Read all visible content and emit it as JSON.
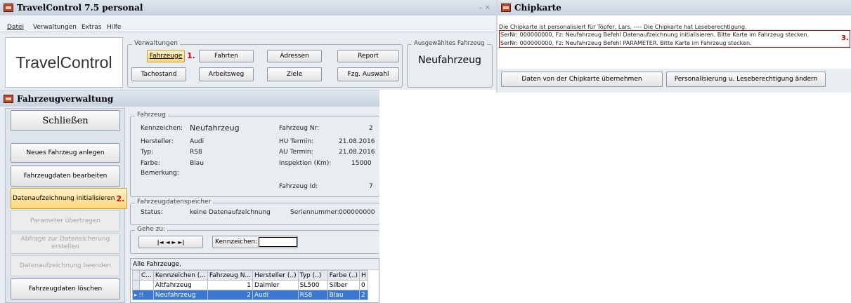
{
  "main_window": {
    "title": "TravelControl 7.5  personal",
    "menu": [
      "Datei",
      "Verwaltungen",
      "Extras",
      "Hilfe"
    ],
    "controls": "– ✕"
  },
  "brand": "TravelControl",
  "verwaltungen": {
    "legend": "Verwaltungen",
    "buttons": {
      "fahrzeuge": "Fahrzeuge",
      "fahrten": "Fahrten",
      "adressen": "Adressen",
      "report": "Report",
      "tachostand": "Tachostand",
      "arbeitsweg": "Arbeitsweg",
      "ziele": "Ziele",
      "fzg_auswahl": "Fzg. Auswahl"
    },
    "step": "1."
  },
  "selected_vehicle": {
    "legend": "Ausgewähltes Fahrzeug",
    "value": "Neufahrzeug"
  },
  "chipkarte": {
    "title": "Chipkarte",
    "info": "Die Chipkarte ist personalisiert für Töpfer, Lars.   ----   Die Chipkarte hat Leseberechtigung.",
    "messages": [
      "SerNr: 000000000, Fz: Neufahrzeug Befehl  Datenaufzeichnung initialisieren. Bitte Karte im Fahrzeug stecken.",
      "SerNr: 000000000, Fz: Neufahrzeug Befehl   PARAMETER. Bitte Karte im Fahrzeug stecken."
    ],
    "step": "3.",
    "btn_uebernehmen": "Daten von der Chipkarte übernehmen",
    "btn_personalisierung": "Personalisierung u. Leseberechtigung ändern"
  },
  "fahrzeugverwaltung": {
    "title": "Fahrzeugverwaltung",
    "schliessen": "Schließen",
    "actions": {
      "neu": "Neues Fahrzeug anlegen",
      "bearbeiten": "Fahrzeugdaten bearbeiten",
      "initialisieren": "Datenaufzeichnung initialisieren",
      "parameter": "Parameter übertragen",
      "abfrage": "Abfrage zur Datensicherung erstellen",
      "beenden": "Datenaufzeichnung beenden",
      "loeschen": "Fahrzeugdaten löschen"
    },
    "step": "2."
  },
  "fahrzeug": {
    "legend": "Fahrzeug",
    "kennzeichen_label": "Kennzeichen:",
    "kennzeichen": "Neufahrzeug",
    "nr_label": "Fahrzeug Nr:",
    "nr": "2",
    "hersteller_label": "Hersteller:",
    "hersteller": "Audi",
    "hu_label": "HU Termin:",
    "hu": "21.08.2016",
    "typ_label": "Typ:",
    "typ": "RS8",
    "au_label": "AU Termin:",
    "au": "21.08.2016",
    "farbe_label": "Farbe:",
    "farbe": "Blau",
    "insp_label": "Inspektion (Km):",
    "insp": "15000",
    "bemerkung_label": "Bemerkung:",
    "id_label": "Fahrzeug Id:",
    "id": "7"
  },
  "speicher": {
    "legend": "Fahrzeugdatenspeicher",
    "status_label": "Status:",
    "status": "keine Datenaufzeichnung",
    "sn_label": "Seriennummer:",
    "sn": "000000000"
  },
  "gehe_zu": {
    "legend": "Gehe zu:",
    "nav": "|◄   ◄   ►   ►|",
    "kennzeichen_label": "Kennzeichen:",
    "kennzeichen_value": ""
  },
  "list": {
    "title": "Alle Fahrzeuge,",
    "headers": [
      "C...",
      "Kennzeichen (...",
      "Fahrzeug N...",
      "Hersteller (..)",
      "Typ (..)",
      "Farbe (..)",
      "H"
    ],
    "rows": [
      [
        "",
        "Altfahrzeug",
        "1",
        "Daimler",
        "SL500",
        "Silber",
        "0"
      ],
      [
        "▸ !!",
        "Neufahrzeug",
        "2",
        "Audi",
        "RS8",
        "Blau",
        "2"
      ]
    ]
  }
}
